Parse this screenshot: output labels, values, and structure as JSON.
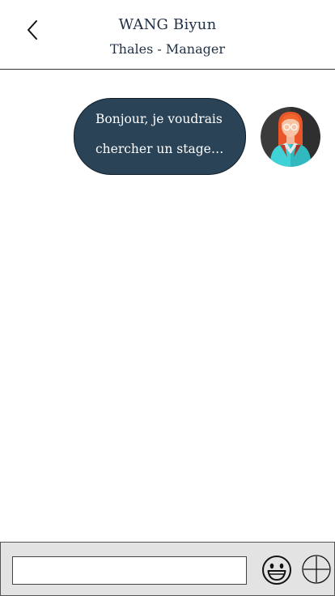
{
  "header": {
    "name": "WANG Biyun",
    "subtitle": "Thales - Manager",
    "back_icon": "chevron-left-icon"
  },
  "messages": [
    {
      "text": "Bonjour, je voudrais\nchercher un stage…",
      "bubble_color": "#2a4356",
      "avatar_icon": "user-avatar-woman-icon"
    }
  ],
  "composer": {
    "input_value": "",
    "input_placeholder": "",
    "emoji_icon": "smiley-face-icon",
    "add_icon": "plus-circle-icon"
  },
  "colors": {
    "header_text": "#1f2f44",
    "bubble": "#2a4356",
    "input_bar_bg": "#e3e3e3"
  }
}
